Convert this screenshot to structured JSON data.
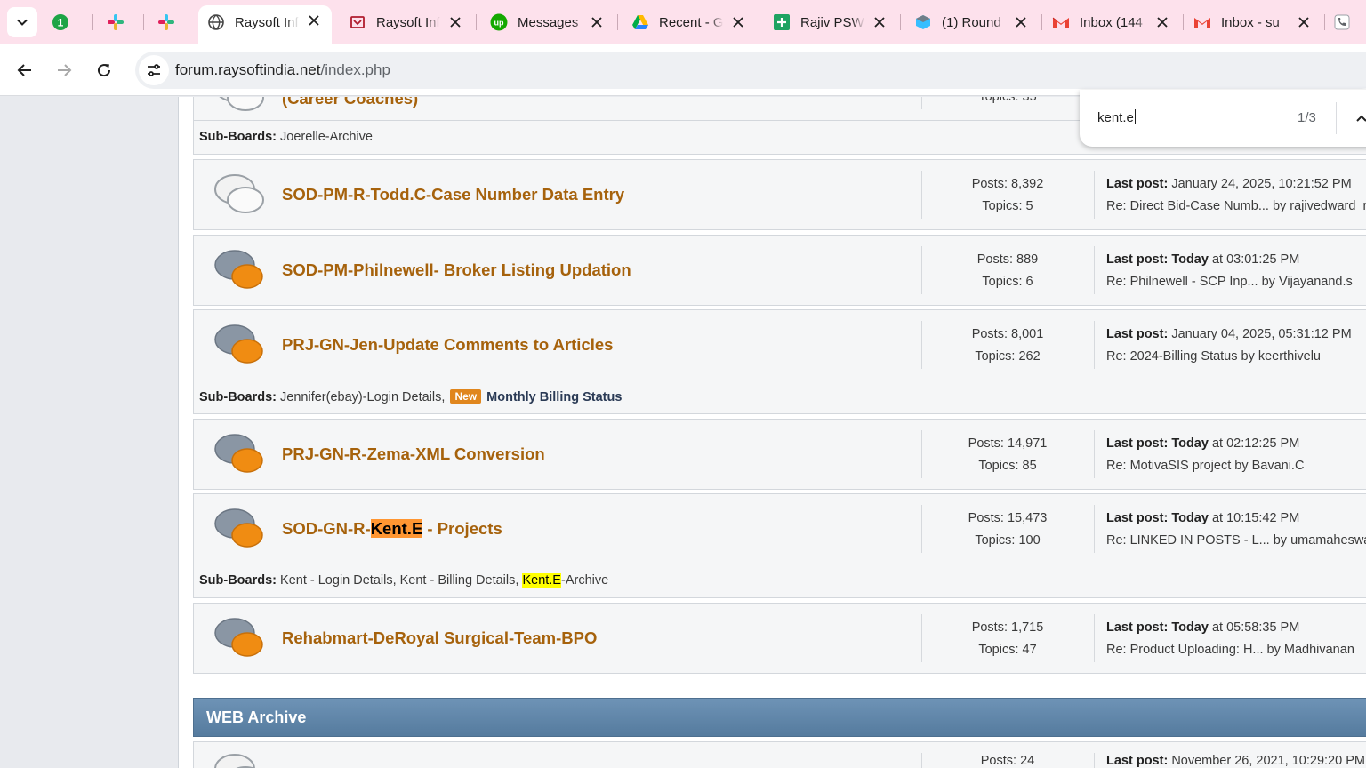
{
  "browser": {
    "tabs": [
      {
        "title": "",
        "favicon": "green-badge-icon",
        "badge": "1"
      },
      {
        "title": "",
        "favicon": "slack-icon"
      },
      {
        "title": "",
        "favicon": "slack-icon"
      },
      {
        "title": "Raysoft Inf",
        "favicon": "globe-icon",
        "active": true
      },
      {
        "title": "Raysoft Inf",
        "favicon": "raysoft-icon"
      },
      {
        "title": "Messages",
        "favicon": "upwork-icon"
      },
      {
        "title": "Recent - G",
        "favicon": "google-drive-icon"
      },
      {
        "title": "Rajiv PSW",
        "favicon": "google-sheets-icon"
      },
      {
        "title": "(1) Round",
        "favicon": "roundcube-icon"
      },
      {
        "title": "Inbox (144",
        "favicon": "gmail-icon"
      },
      {
        "title": "Inbox - su",
        "favicon": "gmail-icon"
      },
      {
        "title": "",
        "favicon": "phone-icon"
      }
    ],
    "url": {
      "domain": "forum.raysoftindia.net",
      "path": "/index.php"
    }
  },
  "find": {
    "query": "kent.e",
    "count": "1/3"
  },
  "boards": [
    {
      "title": "(Career Coaches)",
      "icon": "chat-bubbles-gray-icon",
      "stats": {
        "topics": "Topics: 35"
      },
      "subboards_label": "Sub-Boards:",
      "subboards_text": "Joerelle-Archive"
    },
    {
      "title": "SOD-PM-R-Todd.C-Case Number Data Entry",
      "icon": "chat-bubbles-gray-icon",
      "posts": "Posts: 8,392",
      "topics": "Topics: 5",
      "lp_label": "Last post:",
      "lp_bold": "",
      "lp_date": "January 24, 2025, 10:21:52 PM",
      "lp_re": "Re: Direct Bid-Case Numb... by rajivedward_r"
    },
    {
      "title": "SOD-PM-Philnewell- Broker Listing Updation",
      "icon": "chat-bubbles-orange-icon",
      "posts": "Posts: 889",
      "topics": "Topics: 6",
      "lp_label": "Last post:",
      "lp_bold": "Today",
      "lp_date": " at 03:01:25 PM",
      "lp_re": "Re: Philnewell - SCP Inp... by Vijayanand.s"
    },
    {
      "title": "PRJ-GN-Jen-Update Comments to Articles",
      "icon": "chat-bubbles-orange-icon",
      "posts": "Posts: 8,001",
      "topics": "Topics: 262",
      "lp_label": "Last post:",
      "lp_bold": "",
      "lp_date": "January 04, 2025, 05:31:12 PM",
      "lp_re": "Re: 2024-Billing Status by keerthivelu",
      "sub_label": "Sub-Boards:",
      "sub_text": "Jennifer(ebay)-Login Details,",
      "sub_badge": "New",
      "sub_strong": "Monthly Billing Status"
    },
    {
      "title": "PRJ-GN-R-Zema-XML Conversion",
      "icon": "chat-bubbles-orange-icon",
      "posts": "Posts: 14,971",
      "topics": "Topics: 85",
      "lp_label": "Last post:",
      "lp_bold": "Today",
      "lp_date": " at 02:12:25 PM",
      "lp_re": "Re: MotivaSIS project by Bavani.C"
    },
    {
      "title_pre": "SOD-GN-R-",
      "title_hl": "Kent.E",
      "title_post": " - Projects",
      "icon": "chat-bubbles-orange-icon",
      "posts": "Posts: 15,473",
      "topics": "Topics: 100",
      "lp_label": "Last post:",
      "lp_bold": "Today",
      "lp_date": " at 10:15:42 PM",
      "lp_re": "Re: LINKED IN POSTS - L... by umamaheswari",
      "sub_label": "Sub-Boards:",
      "sub_text": "Kent - Login Details, Kent - Billing Details,",
      "sub_hl": "Kent.E",
      "sub_post": "-Archive"
    },
    {
      "title": "Rehabmart-DeRoyal Surgical-Team-BPO",
      "icon": "chat-bubbles-orange-icon",
      "posts": "Posts: 1,715",
      "topics": "Topics: 47",
      "lp_label": "Last post:",
      "lp_bold": "Today",
      "lp_date": " at 05:58:35 PM",
      "lp_re": "Re: Product Uploading: H... by Madhivanan"
    }
  ],
  "category": {
    "title": "WEB Archive"
  },
  "archive_row": {
    "posts": "Posts: 24",
    "lp_label": "Last post:",
    "lp_date": "November 26, 2021, 10:29:20 PM"
  }
}
